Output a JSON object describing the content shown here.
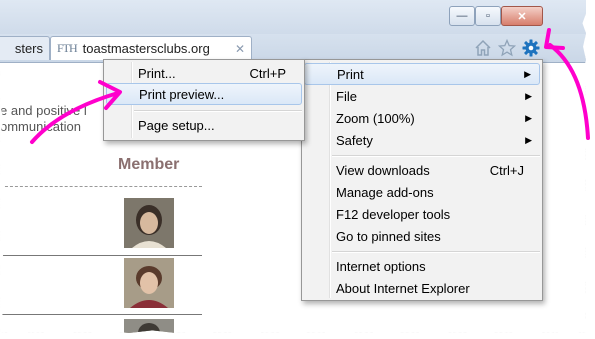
{
  "browser": {
    "caption": {
      "minimize": "—",
      "maximize": "▫",
      "close": "✕"
    },
    "tabs": [
      {
        "label": "sters"
      },
      {
        "favicon": "FTH",
        "label": "toastmastersclubs.org",
        "close": "✕"
      }
    ],
    "toolbar_icons": [
      "home-icon",
      "star-icon",
      "gear-icon"
    ]
  },
  "page": {
    "text_line_1": "e and positive l",
    "text_line_2": "ommunication",
    "member_heading": "Member"
  },
  "gear_menu": {
    "items": [
      {
        "label": "Print",
        "submenu": "▶"
      },
      {
        "label": "File",
        "submenu": "▶"
      },
      {
        "label": "Zoom (100%)",
        "submenu": "▶"
      },
      {
        "label": "Safety",
        "submenu": "▶"
      },
      {
        "label": "View downloads",
        "shortcut": "Ctrl+J"
      },
      {
        "label": "Manage add-ons"
      },
      {
        "label": "F12 developer tools"
      },
      {
        "label": "Go to pinned sites"
      },
      {
        "label": "Internet options"
      },
      {
        "label": "About Internet Explorer"
      }
    ]
  },
  "print_menu": {
    "items": [
      {
        "label": "Print...",
        "shortcut": "Ctrl+P"
      },
      {
        "label": "Print preview..."
      },
      {
        "label": "Page setup..."
      }
    ]
  },
  "colors": {
    "annotation_arrow": "#ff00cc",
    "gear_icon": "#1e73be",
    "menu_hover": "#dbe8f7"
  }
}
